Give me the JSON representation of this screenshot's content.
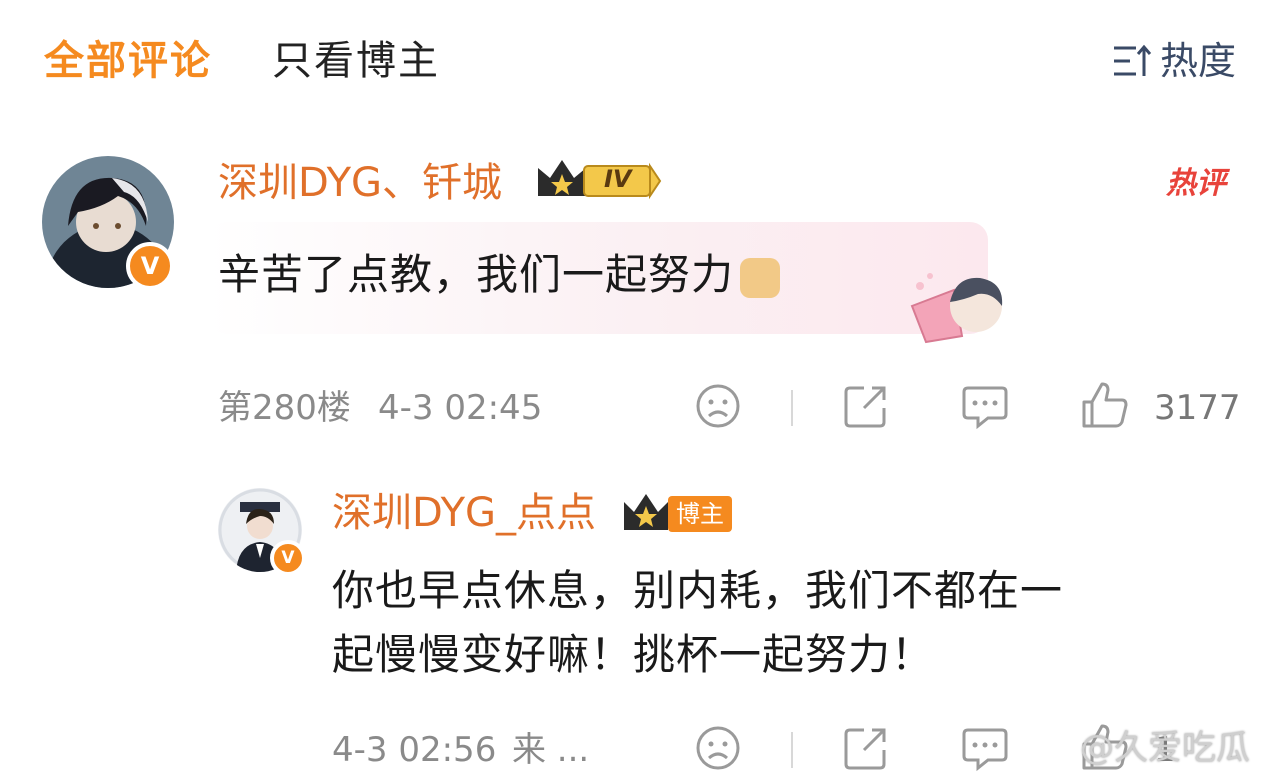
{
  "tabs": {
    "all": "全部评论",
    "blogger_only": "只看博主"
  },
  "sort": {
    "label": "热度",
    "icon": "sort-icon"
  },
  "comment1": {
    "username": "深圳DYG、钎城",
    "level": "IV",
    "hot_tag": "热评",
    "text": "辛苦了点教，我们一起努力",
    "floor": "第280楼",
    "time": "4-3 02:45",
    "likes": "3177"
  },
  "reply1": {
    "username": "深圳DYG_点点",
    "tag": "博主",
    "text_line1": "你也早点休息，别内耗，我们不都在一",
    "text_line2": "起慢慢变好嘛！挑杯一起努力！",
    "time": "4-3 02:56",
    "source": "来 ...",
    "likes": "1"
  },
  "watermark": "@久爱吃瓜",
  "colors": {
    "accent": "#f58a1f",
    "username": "#e0702a",
    "hot": "#e8433b"
  }
}
